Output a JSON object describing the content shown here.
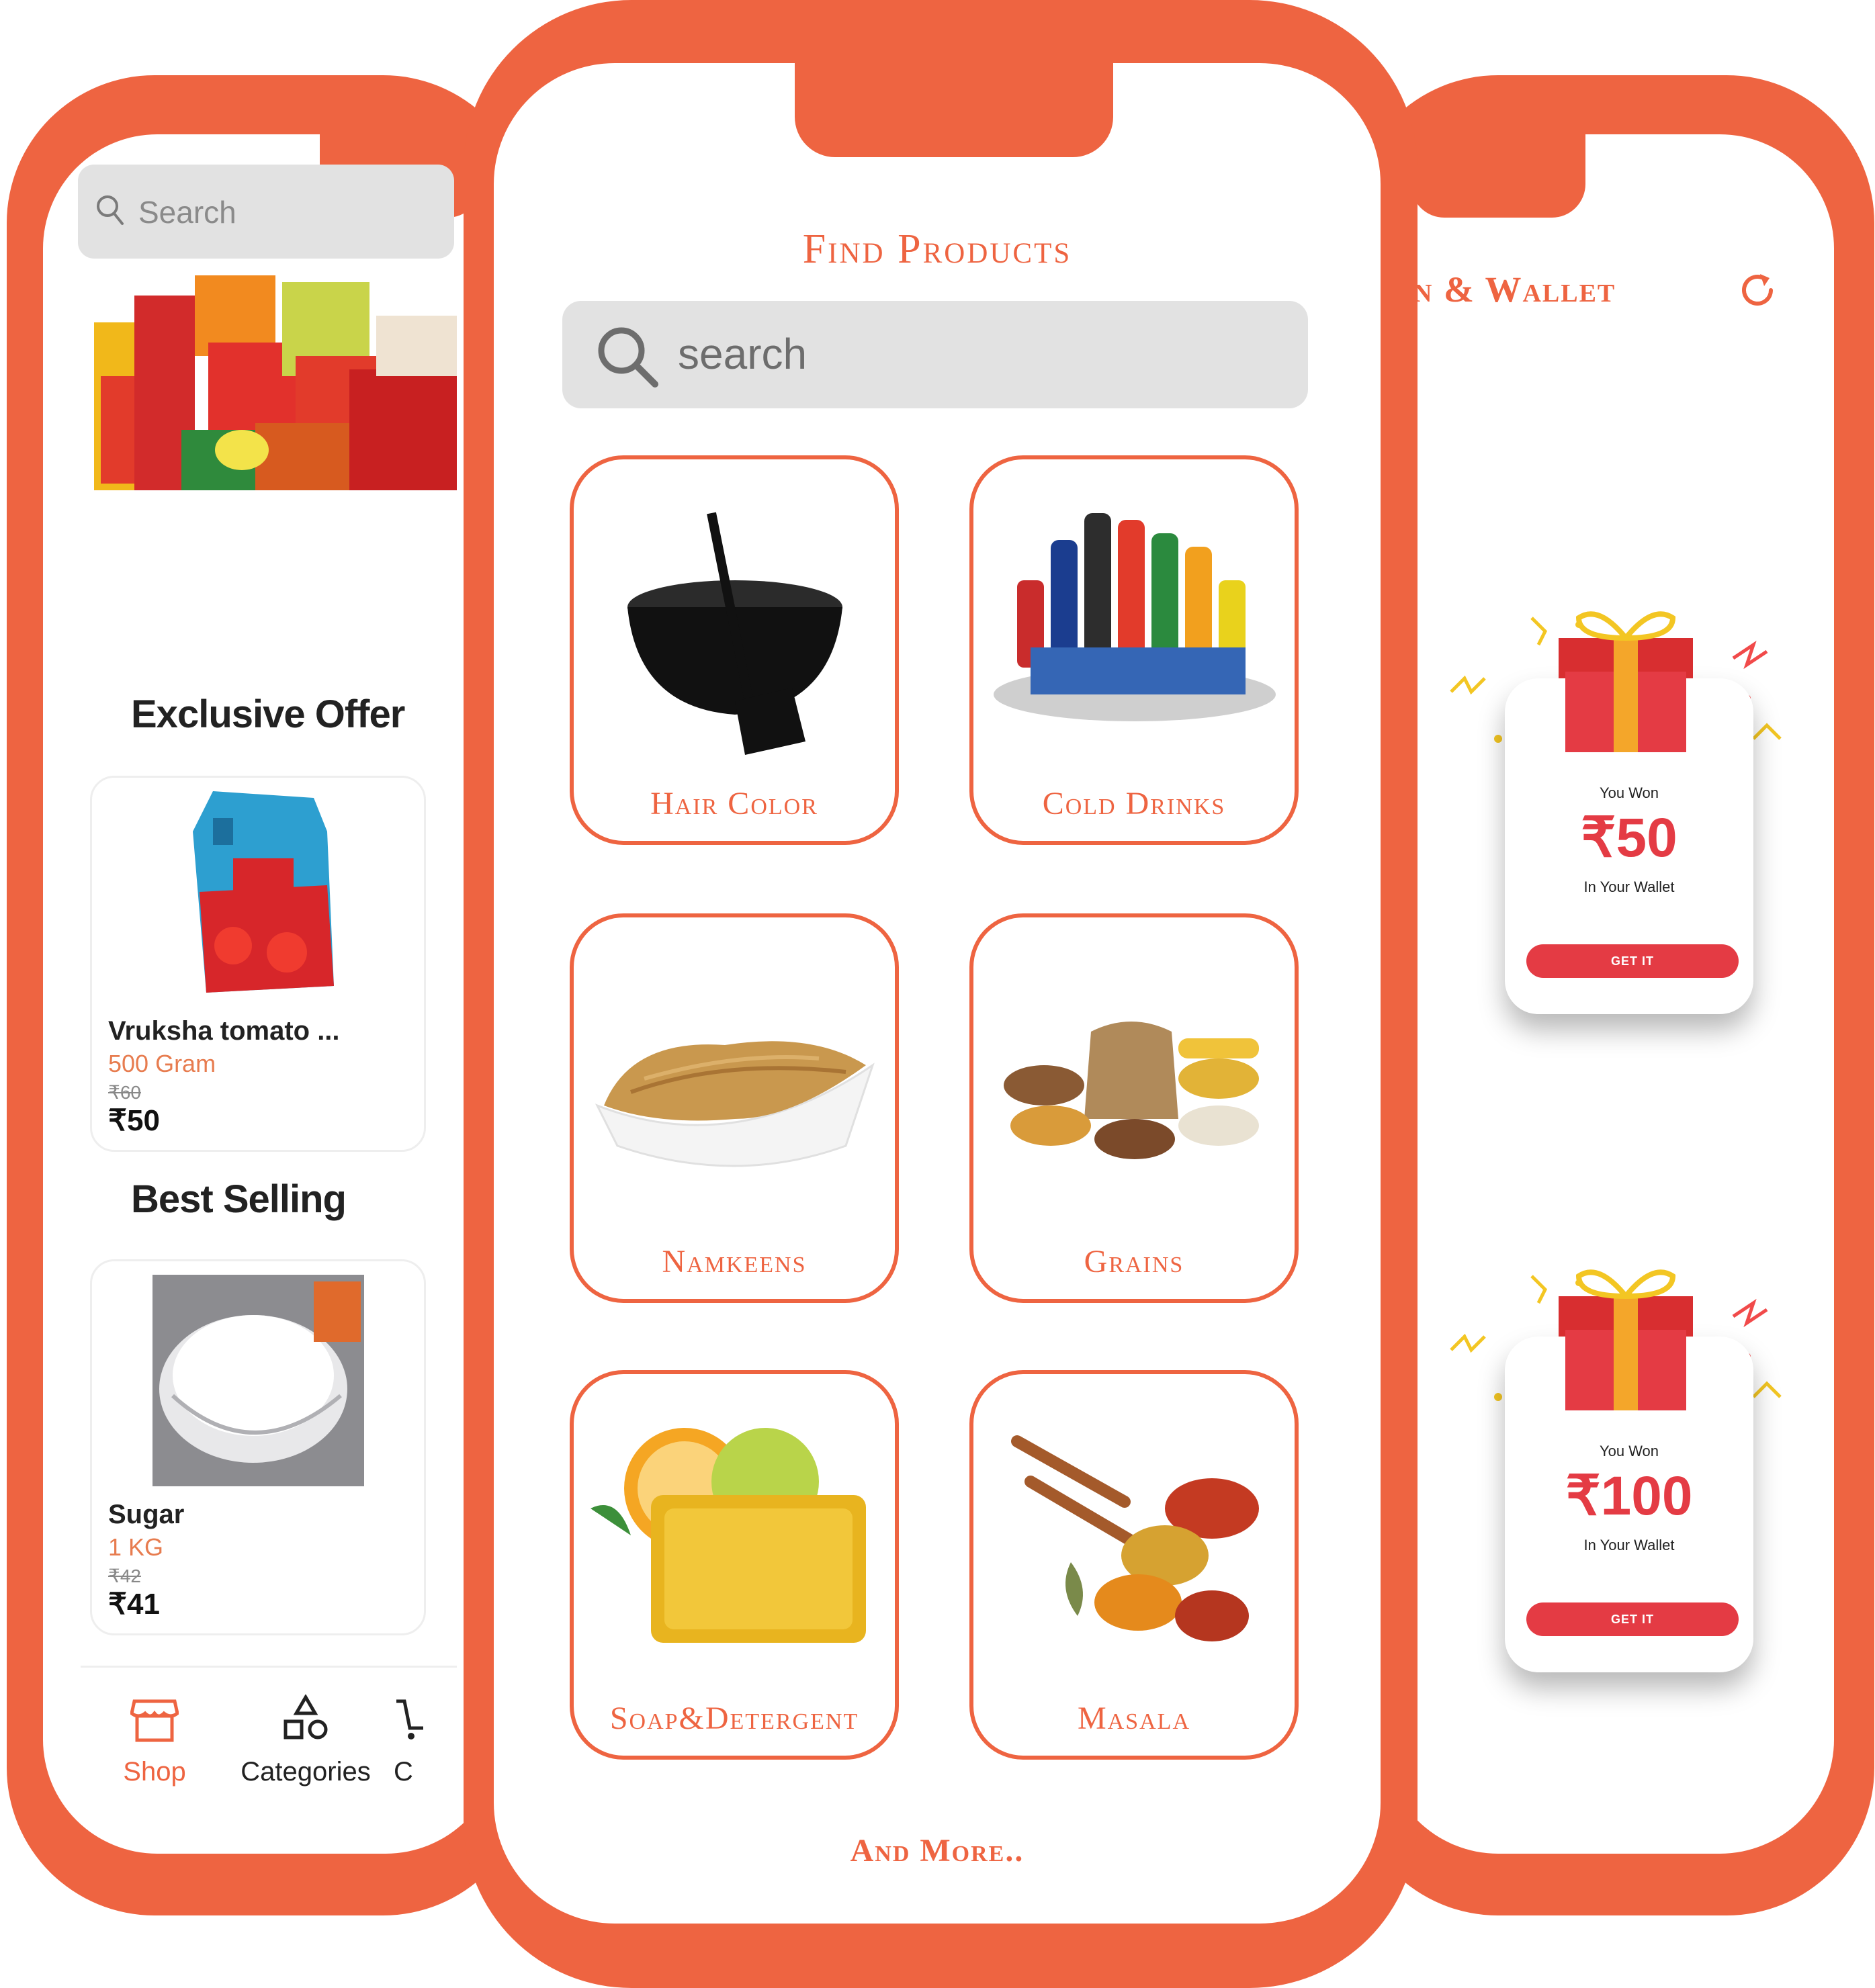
{
  "left_screen": {
    "search_placeholder": "Search",
    "exclusive_title": "Exclusive Offer",
    "exclusive_product": {
      "name": "Vruksha tomato ...",
      "qty": "500 Gram",
      "old_price": "₹60",
      "price": "₹50"
    },
    "best_title": "Best Selling",
    "best_product": {
      "name": "Sugar",
      "qty": "1 KG",
      "old_price": "₹42",
      "price": "₹41"
    },
    "tabs": [
      {
        "label": "Shop",
        "icon": "store-icon",
        "active": true
      },
      {
        "label": "Categories",
        "icon": "shapes-icon",
        "active": false
      },
      {
        "label": "C",
        "icon": "cart-icon",
        "active": false
      }
    ]
  },
  "center_screen": {
    "title": "Find Products",
    "search_placeholder": "search",
    "categories": [
      {
        "label": "Hair Color",
        "icon": "hair-dye-bowl-icon"
      },
      {
        "label": "Cold Drinks",
        "icon": "soft-drinks-icon"
      },
      {
        "label": "Namkeens",
        "icon": "namkeen-snack-icon"
      },
      {
        "label": "Grains",
        "icon": "grains-sack-icon"
      },
      {
        "label": "Soap&Detergent",
        "icon": "soap-bar-icon"
      },
      {
        "label": "Masala",
        "icon": "spice-spoons-icon"
      }
    ],
    "more_label": "And More.."
  },
  "right_screen": {
    "title": "n & Wallet",
    "refresh_icon": "refresh-icon",
    "rewards": [
      {
        "won_label": "You Won",
        "amount": "₹50",
        "sub": "In Your Wallet",
        "button": "GET IT"
      },
      {
        "won_label": "You Won",
        "amount": "₹100",
        "sub": "In Your Wallet",
        "button": "GET IT"
      }
    ]
  },
  "colors": {
    "accent": "#ee6441",
    "reward_red": "#e43b44",
    "search_bg": "#e2e2e2"
  }
}
